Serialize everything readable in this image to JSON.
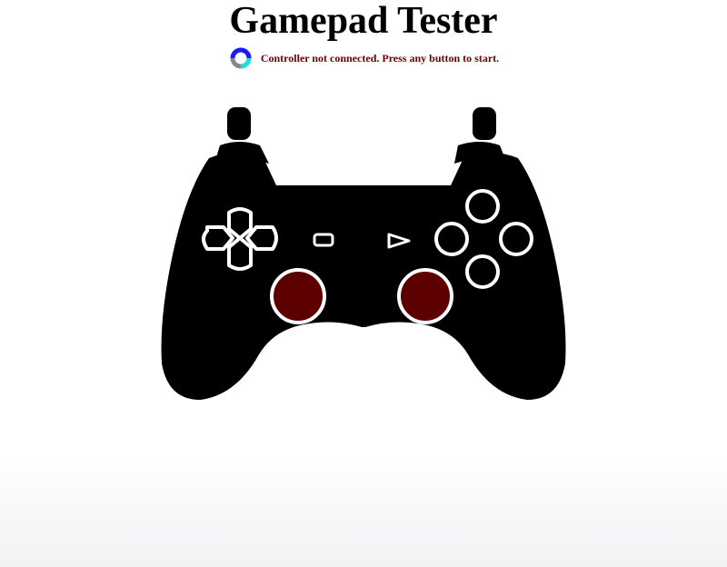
{
  "header": {
    "title": "Gamepad Tester"
  },
  "status": {
    "icon": "connection-spinner-icon",
    "message": "Controller not connected. Press any button to start.",
    "message_color": "#6b0000"
  },
  "controller": {
    "body_color": "#000000",
    "outline_color": "#ffffff",
    "stick_fill_color": "#5c0000",
    "spinner_colors": [
      "#1a1aff",
      "#22dddd",
      "#888888"
    ]
  }
}
